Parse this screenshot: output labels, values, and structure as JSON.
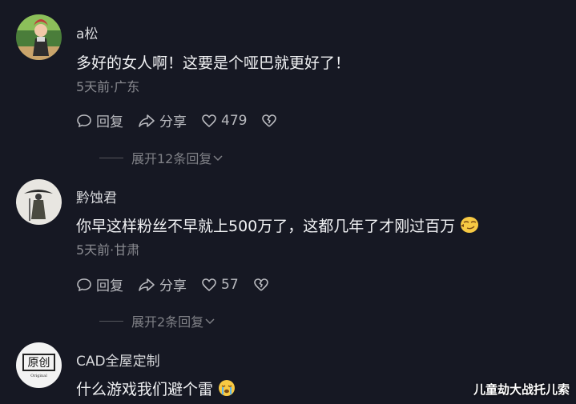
{
  "comments": [
    {
      "username": "a松",
      "content": "多好的女人啊！这要是个哑巴就更好了！",
      "meta": "5天前·广东",
      "reply_label": "回复",
      "share_label": "分享",
      "likes": "479",
      "expand_label": "展开12条回复"
    },
    {
      "username": "黔蚀君",
      "content": "你早这样粉丝不早就上500万了，这都几年了才刚过百万",
      "meta": "5天前·甘肃",
      "reply_label": "回复",
      "share_label": "分享",
      "likes": "57",
      "expand_label": "展开2条回复"
    },
    {
      "username": "CAD全屋定制",
      "content": "什么游戏我们避个雷",
      "avatar_text": "原创",
      "avatar_subtext": "Original"
    }
  ],
  "watermark": "儿童劫大战托儿索",
  "colors": {
    "background": "#161823",
    "meta": "#8a8b91",
    "text": "#f1f2f4"
  }
}
